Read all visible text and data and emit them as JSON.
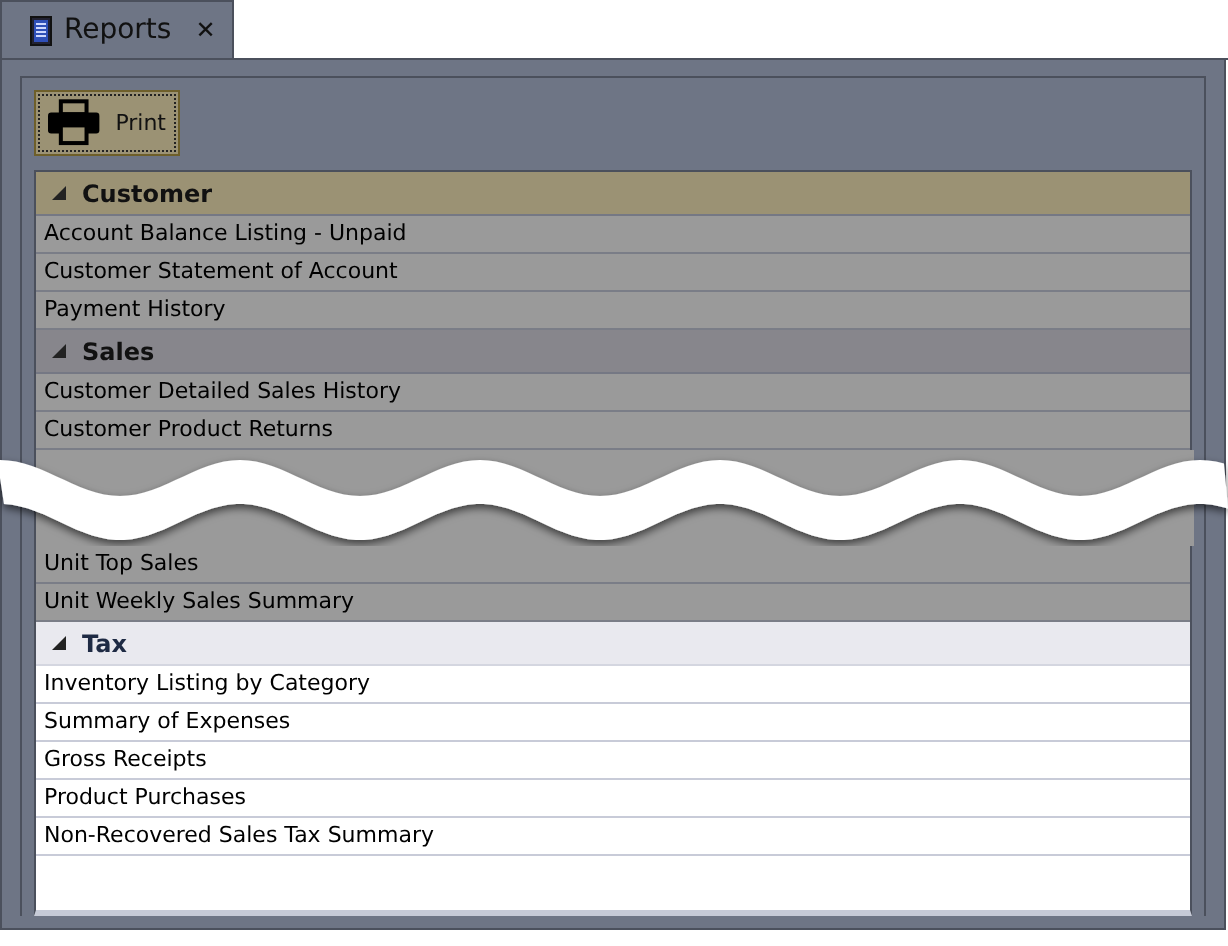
{
  "tab": {
    "title": "Reports",
    "close": "✕",
    "selected": true
  },
  "print_button": {
    "label": "Print",
    "focused": true
  },
  "groups": [
    {
      "name": "Customer",
      "expanded": true,
      "selected": true,
      "highlighted": false,
      "items": [
        {
          "kind": "row",
          "label": "Account Balance Listing - Unpaid"
        },
        {
          "kind": "row",
          "label": "Customer Statement of Account"
        },
        {
          "kind": "row",
          "label": "Payment History"
        }
      ]
    },
    {
      "name": "Sales",
      "expanded": true,
      "selected": false,
      "highlighted": false,
      "items": [
        {
          "kind": "row",
          "label": "Customer Detailed Sales History"
        },
        {
          "kind": "row",
          "label": "Customer Product Returns"
        },
        {
          "kind": "break"
        },
        {
          "kind": "row",
          "label": "Unit Top Sales"
        },
        {
          "kind": "row",
          "label": "Unit Weekly Sales Summary"
        }
      ]
    },
    {
      "name": "Tax",
      "expanded": true,
      "selected": false,
      "highlighted": true,
      "items": [
        {
          "kind": "row",
          "label": "Inventory Listing by Category"
        },
        {
          "kind": "row",
          "label": "Summary of Expenses"
        },
        {
          "kind": "row",
          "label": "Gross Receipts"
        },
        {
          "kind": "row",
          "label": "Product Purchases"
        },
        {
          "kind": "row",
          "label": "Non-Recovered Sales Tax Summary"
        }
      ]
    }
  ]
}
